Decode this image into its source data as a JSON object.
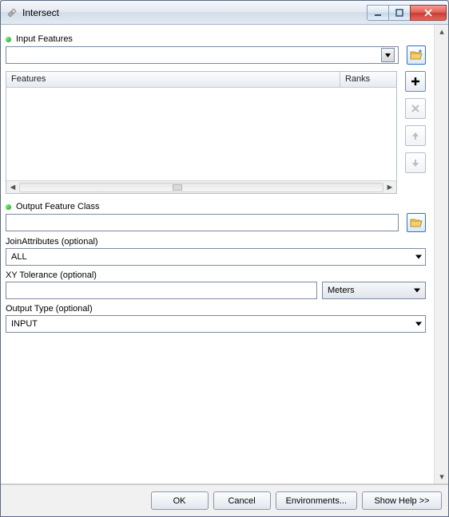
{
  "window": {
    "title": "Intersect"
  },
  "sections": {
    "inputFeatures": {
      "label": "Input Features",
      "value": ""
    },
    "featuresTable": {
      "col_features": "Features",
      "col_ranks": "Ranks"
    },
    "outputFeatureClass": {
      "label": "Output Feature Class",
      "value": ""
    },
    "joinAttributes": {
      "label": "JoinAttributes (optional)",
      "value": "ALL"
    },
    "xyTolerance": {
      "label": "XY Tolerance (optional)",
      "value": "",
      "unit": "Meters"
    },
    "outputType": {
      "label": "Output Type (optional)",
      "value": "INPUT"
    }
  },
  "buttons": {
    "ok": "OK",
    "cancel": "Cancel",
    "environments": "Environments...",
    "showHelp": "Show Help >>"
  }
}
